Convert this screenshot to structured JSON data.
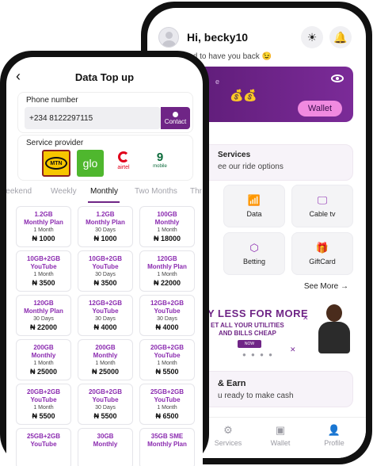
{
  "back_screen": {
    "greeting": "Hi, becky10",
    "subgreeting": "lad to have you back 😉",
    "wallet_card": {
      "money_emoji": "💰💰",
      "label_fragment": "e",
      "wallet_button": "Wallet"
    },
    "services_card": {
      "title": "Services",
      "subtitle": "ee our ride options"
    },
    "tiles": [
      {
        "label": "Data",
        "icon": "wifi-icon"
      },
      {
        "label": "Cable tv",
        "icon": "tv-icon"
      },
      {
        "label": "Betting",
        "icon": "cube-icon"
      },
      {
        "label": "GiftCard",
        "icon": "gift-icon"
      }
    ],
    "see_more": "See More →",
    "promo": {
      "line1": "Y LESS FOR MORE",
      "line2": "ET ALL YOUR UTILITIES",
      "line3": "AND BILLS CHEAP",
      "button": "NOW",
      "dots": "● ● ● ●"
    },
    "earn_card": {
      "title": "& Earn",
      "subtitle": "u ready to make cash"
    },
    "bottom_nav": [
      {
        "label": "Services",
        "icon": "gear-icon"
      },
      {
        "label": "Wallet",
        "icon": "wallet-icon"
      },
      {
        "label": "Profile",
        "icon": "user-icon"
      }
    ]
  },
  "front_screen": {
    "title": "Data Top up",
    "phone": {
      "label": "Phone number",
      "value": "+234 8122297115",
      "contact_label": "Contact"
    },
    "provider": {
      "label": "Service provider",
      "mtn": "MTN",
      "glo": "glo",
      "airtel": "airtel",
      "nine": "9",
      "mobile": "mobile"
    },
    "tabs": [
      "Weekend",
      "Weekly",
      "Monthly",
      "Two Months",
      "Thr"
    ],
    "active_tab": "Monthly",
    "plans": [
      {
        "name": "1.2GB\nMonthly Plan",
        "duration": "1 Month",
        "price": "₦ 1000"
      },
      {
        "name": "1.2GB\nMonthly Plan",
        "duration": "30 Days",
        "price": "₦ 1000"
      },
      {
        "name": "100GB\nMonthly",
        "duration": "1 Month",
        "price": "₦ 18000"
      },
      {
        "name": "10GB+2GB\nYouTube",
        "duration": "1 Month",
        "price": "₦ 3500"
      },
      {
        "name": "10GB+2GB\nYouTube",
        "duration": "30 Days",
        "price": "₦ 3500"
      },
      {
        "name": "120GB\nMonthly Plan",
        "duration": "1 Month",
        "price": "₦ 22000"
      },
      {
        "name": "120GB\nMonthly Plan",
        "duration": "30 Days",
        "price": "₦ 22000"
      },
      {
        "name": "12GB+2GB\nYouTube",
        "duration": "30 Days",
        "price": "₦ 4000"
      },
      {
        "name": "12GB+2GB\nYouTube",
        "duration": "30 Days",
        "price": "₦ 4000"
      },
      {
        "name": "200GB\nMonthly",
        "duration": "1 Month",
        "price": "₦ 25000"
      },
      {
        "name": "200GB\nMonthly",
        "duration": "1 Month",
        "price": "₦ 25000"
      },
      {
        "name": "20GB+2GB\nYouTube",
        "duration": "1 Month",
        "price": "₦ 5500"
      },
      {
        "name": "20GB+2GB\nYouTube",
        "duration": "1 Month",
        "price": "₦ 5500"
      },
      {
        "name": "20GB+2GB\nYouTube",
        "duration": "30 Days",
        "price": "₦ 5500"
      },
      {
        "name": "25GB+2GB\nYouTube",
        "duration": "1 Month",
        "price": "₦ 6500"
      },
      {
        "name": "25GB+2GB\nYouTube",
        "duration": "",
        "price": ""
      },
      {
        "name": "30GB\nMonthly",
        "duration": "",
        "price": ""
      },
      {
        "name": "35GB SME\nMonthly Plan",
        "duration": "",
        "price": ""
      }
    ]
  },
  "colors": {
    "brand_purple": "#6f2586",
    "plan_name_purple": "#8b2bb0",
    "wallet_button_pink": "#f08ae0"
  }
}
